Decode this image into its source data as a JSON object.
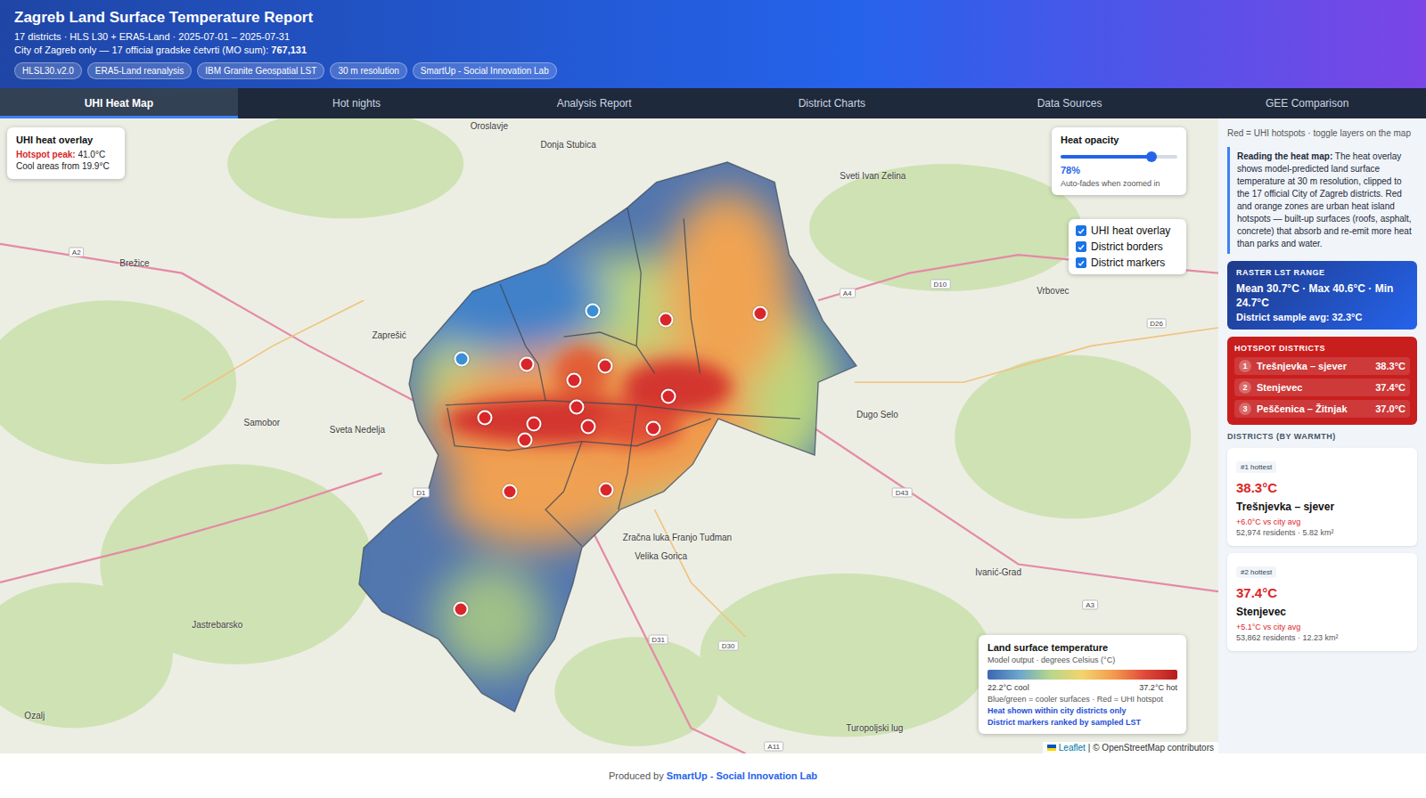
{
  "header": {
    "title": "Zagreb Land Surface Temperature Report",
    "subtitle": "17 districts · HLS L30 + ERA5-Land · 2025-07-01 – 2025-07-31",
    "scope_label": "City of Zagreb only — 17 official gradske četvrti (MO sum): ",
    "scope_value": "767,131",
    "badges": [
      "HLSL30.v2.0",
      "ERA5-Land reanalysis",
      "IBM Granite Geospatial LST",
      "30 m resolution",
      "SmartUp - Social Innovation Lab"
    ]
  },
  "tabs": [
    {
      "label": "UHI Heat Map",
      "selected": true
    },
    {
      "label": "Hot nights",
      "selected": false
    },
    {
      "label": "Analysis Report",
      "selected": false
    },
    {
      "label": "District Charts",
      "selected": false
    },
    {
      "label": "Data Sources",
      "selected": false
    },
    {
      "label": "GEE Comparison",
      "selected": false
    }
  ],
  "map": {
    "overlay_card": {
      "title": "UHI heat overlay",
      "peak_label": "Hotspot peak:",
      "peak_value": "41.0°C",
      "cool_text": "Cool areas from 19.9°C"
    },
    "opacity": {
      "title": "Heat opacity",
      "level": 0.78,
      "reading": "78%",
      "hint": "Auto-fades when zoomed in"
    },
    "layers": [
      {
        "label": "UHI heat overlay",
        "checked": true
      },
      {
        "label": "District borders",
        "checked": true
      },
      {
        "label": "District markers",
        "checked": true
      }
    ],
    "legend": {
      "title": "Land surface temperature",
      "subtitle": "Model output · degrees Celsius (°C)",
      "low": "22.2°C cool",
      "high": "37.2°C hot",
      "note": "Blue/green = cooler surfaces · Red = UHI hotspot",
      "links": [
        "Heat shown within city districts only",
        "District markers ranked by sampled LST"
      ]
    },
    "attribution": {
      "link": "Leaflet",
      "text": "| © OpenStreetMap contributors"
    },
    "places": [
      "Oroslavje",
      "Donja Stubica",
      "Sveti Ivan Zelina",
      "Brežice",
      "Zaprešić",
      "Samobor",
      "Sveta Nedelja",
      "Dugo Selo",
      "Vrbovec",
      "Velika Gorica",
      "Ivanić-Grad",
      "Jastrebarsko",
      "Ozalj",
      "Turopoljski lug",
      "Zračna luka Franjo Tuđman"
    ],
    "roads": [
      "A2",
      "A4",
      "D10",
      "D26",
      "D1",
      "D43",
      "A3",
      "D31",
      "D30",
      "A11"
    ],
    "markers": [
      {
        "color": "#3b8fd6"
      },
      {
        "color": "#3b8fd6"
      },
      {
        "color": "#d9262b"
      },
      {
        "color": "#d9262b"
      },
      {
        "color": "#d9262b"
      },
      {
        "color": "#d9262b"
      },
      {
        "color": "#d9262b"
      },
      {
        "color": "#d9262b"
      },
      {
        "color": "#d9262b"
      },
      {
        "color": "#d9262b"
      },
      {
        "color": "#d9262b"
      },
      {
        "color": "#d9262b"
      },
      {
        "color": "#d9262b"
      },
      {
        "color": "#d9262b"
      },
      {
        "color": "#d9262b"
      },
      {
        "color": "#d9262b"
      },
      {
        "color": "#d9262b"
      }
    ]
  },
  "sidebar": {
    "intro": "Red = UHI hotspots · toggle layers on the map",
    "info_bold": "Reading the heat map:",
    "info_text": " The heat overlay shows model-predicted land surface temperature at 30 m resolution, clipped to the 17 official City of Zagreb districts. Red and orange zones are urban heat island hotspots — built-up surfaces (roofs, asphalt, concrete) that absorb and re-emit more heat than parks and water.",
    "raster": {
      "title": "RASTER LST RANGE",
      "value": "Mean 30.7°C · Max 40.6°C · Min 24.7°C",
      "avg": "District sample avg: 32.3°C"
    },
    "hotspots": {
      "title": "HOTSPOT DISTRICTS",
      "rows": [
        {
          "rank": "1",
          "name": "Trešnjevka – sjever",
          "temp": "38.3°C"
        },
        {
          "rank": "2",
          "name": "Stenjevec",
          "temp": "37.4°C"
        },
        {
          "rank": "3",
          "name": "Peščenica – Žitnjak",
          "temp": "37.0°C"
        }
      ]
    },
    "districts_title": "DISTRICTS (BY WARMTH)",
    "districts": [
      {
        "rank_label": "#1 hottest",
        "temp": "38.3°C",
        "name": "Trešnjevka – sjever",
        "delta": "+6.0°C vs city avg",
        "meta": "52,974 residents · 5.82 km²"
      },
      {
        "rank_label": "#2 hottest",
        "temp": "37.4°C",
        "name": "Stenjevec",
        "delta": "+5.1°C vs city avg",
        "meta": "53,862 residents · 12.23 km²"
      }
    ]
  },
  "footer": {
    "prefix": "Produced by ",
    "link": "SmartUp - Social Innovation Lab"
  }
}
